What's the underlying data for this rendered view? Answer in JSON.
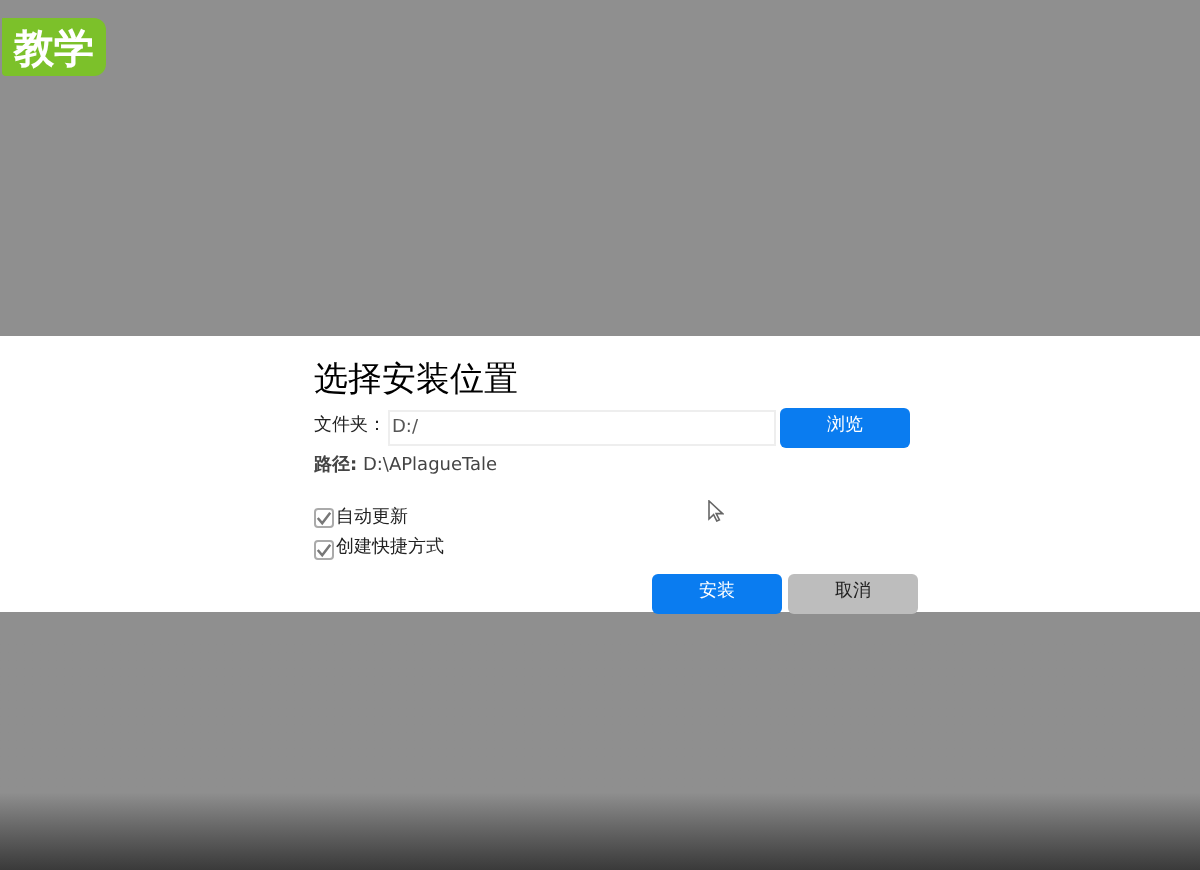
{
  "badge": {
    "label": "教学"
  },
  "dialog": {
    "title": "选择安装位置",
    "folder": {
      "label": "文件夹：",
      "value": "D:/"
    },
    "browse_button": "浏览",
    "path": "**路径:** D:\\APlagueTale",
    "options": [
      {
        "label": "自动更新",
        "checked": true
      },
      {
        "label": "创建快捷方式",
        "checked": true
      }
    ],
    "buttons": [
      {
        "label": "安装",
        "kind": "primary"
      },
      {
        "label": "取消",
        "kind": "secondary"
      }
    ]
  }
}
